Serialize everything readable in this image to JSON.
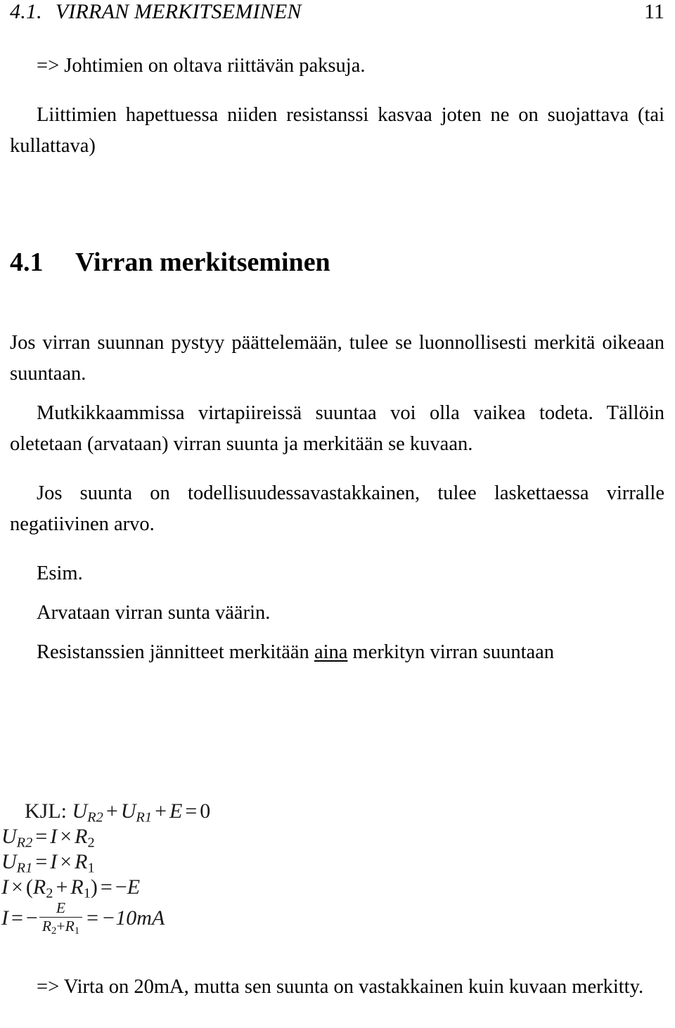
{
  "header": {
    "section_number": "4.1.",
    "section_title": "VIRRAN MERKITSEMINEN",
    "page_number": "11"
  },
  "body": {
    "note_conductors": "=> Johtimien on oltava riittävän paksuja.",
    "para_terminals": "Liittimien hapettuessa niiden resistanssi kasvaa joten ne on suojattava (tai kullattava)",
    "section_heading_number": "4.1",
    "section_heading_title": "Virran merkitseminen",
    "para_direction": "Jos virran suunnan pystyy päättelemään, tulee se luonnollisesti merkitä oikeaan suuntaan.",
    "para_complex": "Mutkikkaammissa virtapiireissä suuntaa voi olla vaikea todeta. Tällöin oletetaan (arvataan) virran suunta ja merkitään se kuvaan.",
    "para_negative": "Jos suunta on todellisuudessavastakkainen, tulee laskettaessa virralle negatiivinen arvo.",
    "example_label": "Esim.",
    "example_intro": "Arvataan virran sunta väärin.",
    "rule_prefix": "Resistanssien jännitteet merkitään ",
    "rule_emphasis": "aina",
    "rule_suffix": " merkityn virran suuntaan",
    "conclusion": "=> Virta on 20mA, mutta sen suunta on vastakkainen kuin kuvaan merkitty."
  },
  "math": {
    "kjl_label": "KJL:",
    "line1": {
      "lhs_U": "U",
      "lhs_sub1": "R2",
      "plus1": "+",
      "U2": "U",
      "sub2": "R1",
      "plus2": "+",
      "E": "E",
      "eq": "=",
      "zero": "0"
    },
    "line2": {
      "U": "U",
      "sub": "R2",
      "eq": "=",
      "I": "I",
      "times": "×",
      "R": "R",
      "rsub": "2"
    },
    "line3": {
      "U": "U",
      "sub": "R1",
      "eq": "=",
      "I": "I",
      "times": "×",
      "R": "R",
      "rsub": "1"
    },
    "line4": {
      "I": "I",
      "times": "×",
      "lparen": "(",
      "R": "R",
      "rsub1": "2",
      "plus": "+",
      "R2": "R",
      "rsub2": "1",
      "rparen": ")",
      "eq": "=",
      "minus": "−",
      "E": "E"
    },
    "line5": {
      "I": "I",
      "eq": "=",
      "minus": "−",
      "num_E": "E",
      "den_R2": "R",
      "den_sub2": "2",
      "den_plus": "+",
      "den_R1": "R",
      "den_sub1": "1",
      "eq2": "=",
      "result": "−10mA"
    }
  },
  "colors": {
    "page_background": "#ffffff",
    "text": "#000000",
    "math_text": "#1a1a1a"
  }
}
